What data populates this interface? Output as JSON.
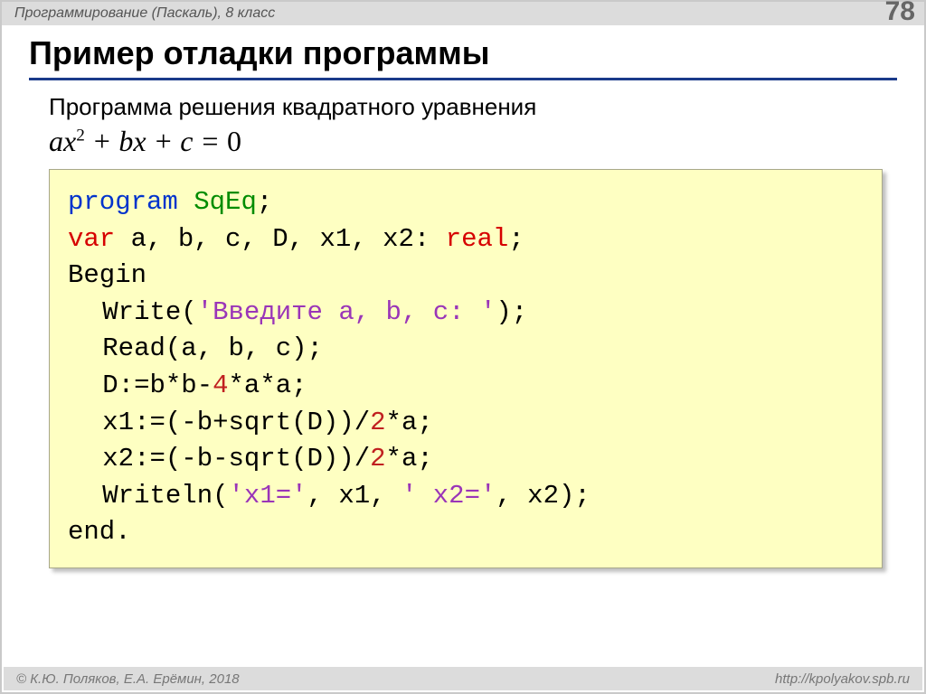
{
  "header": {
    "left": "Программирование (Паскаль), 8 класс",
    "page_number": "78"
  },
  "title": "Пример отладки программы",
  "subtitle": "Программа решения квадратного уравнения",
  "equation": {
    "a": "ax",
    "sup": "2",
    "mid": " + bx + c = ",
    "rhs": "0"
  },
  "code": {
    "kw_program": "program",
    "prog_name": "SqEq",
    "kw_var": "var",
    "var_list": " a, b, c, D, x1, x2: ",
    "kw_real": "real",
    "kw_begin": "Begin",
    "write": "Write(",
    "str_prompt": "'Введите a, b, c: '",
    "read": "Read(a, b, c);",
    "d_assign_pre": "D:=b*b-",
    "d_four": "4",
    "d_assign_post": "*a*a;",
    "x1_pre": "x1:=(-b+sqrt(D))/",
    "x1_two": "2",
    "x1_post": "*a;",
    "x2_pre": "x2:=(-b-sqrt(D))/",
    "x2_two": "2",
    "x2_post": "*a;",
    "writeln": "Writeln(",
    "str_x1": "'x1='",
    "mid1": ", x1, ",
    "str_x2": "' x2='",
    "mid2": ", x2);",
    "kw_end": "end."
  },
  "footer": {
    "left": "© К.Ю. Поляков, Е.А. Ерёмин, 2018",
    "right": "http://kpolyakov.spb.ru"
  }
}
